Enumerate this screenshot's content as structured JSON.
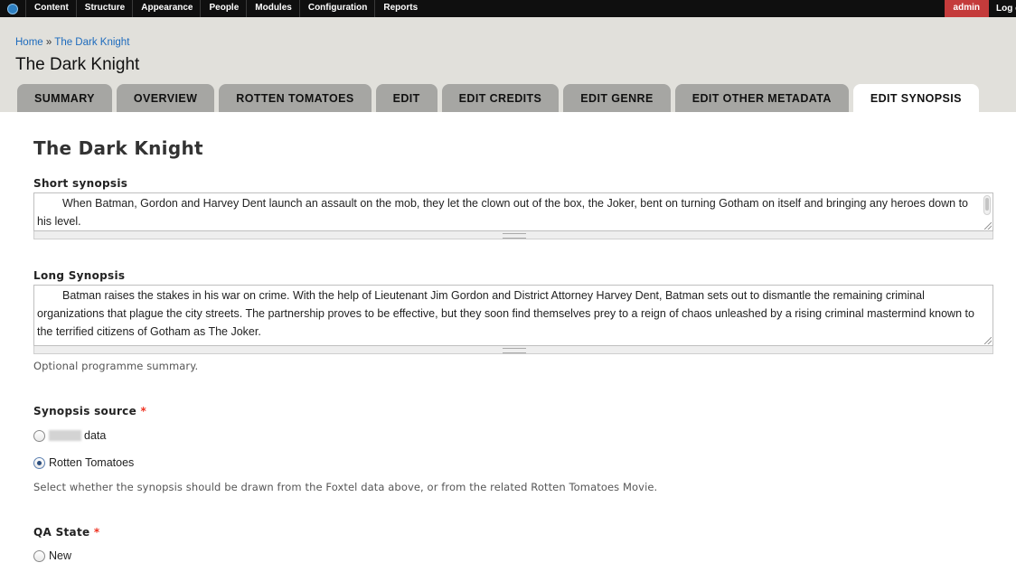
{
  "toolbar": {
    "items": [
      "Content",
      "Structure",
      "Appearance",
      "People",
      "Modules",
      "Configuration",
      "Reports"
    ],
    "user": "admin",
    "logout": "Log out"
  },
  "breadcrumb": {
    "home": "Home",
    "separator": "»",
    "current": "The Dark Knight"
  },
  "page_title": "The Dark Knight",
  "tabs": [
    "SUMMARY",
    "OVERVIEW",
    "ROTTEN TOMATOES",
    "EDIT",
    "EDIT CREDITS",
    "EDIT GENRE",
    "EDIT OTHER METADATA",
    "EDIT SYNOPSIS"
  ],
  "active_tab": "EDIT SYNOPSIS",
  "form": {
    "title": "The Dark Knight",
    "short_synopsis": {
      "label": "Short synopsis",
      "value": "When Batman, Gordon and Harvey Dent launch an assault on the mob, they let the clown out of the box, the Joker, bent on turning Gotham on itself and bringing any heroes down to his level."
    },
    "long_synopsis": {
      "label": "Long Synopsis",
      "value": "Batman raises the stakes in his war on crime. With the help of Lieutenant Jim Gordon and District Attorney Harvey Dent, Batman sets out to dismantle the remaining criminal organizations that plague the city streets. The partnership proves to be effective, but they soon find themselves prey to a reign of chaos unleashed by a rising criminal mastermind known to the terrified citizens of Gotham as The Joker.",
      "description": "Optional programme summary."
    },
    "synopsis_source": {
      "label": "Synopsis source",
      "required_mark": "*",
      "options": [
        "data",
        "Rotten Tomatoes"
      ],
      "selected": "Rotten Tomatoes",
      "description": "Select whether the synopsis should be drawn from the Foxtel data above, or from the related Rotten Tomatoes Movie."
    },
    "qa_state": {
      "label": "QA State",
      "required_mark": "*",
      "options": [
        "New"
      ]
    }
  },
  "colors": {
    "toolbar_bg": "#0f0f0f",
    "admin_bg": "#c43b3b",
    "header_bg": "#e1e0db",
    "tab_bg": "#a6a6a3",
    "link": "#1d6bbd",
    "required": "#ee3322"
  },
  "icons": {
    "toolbar_home": "drupal-drop-icon"
  }
}
